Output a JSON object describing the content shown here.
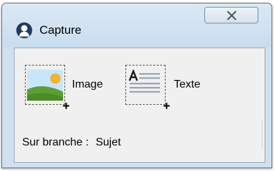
{
  "window": {
    "title": "Capture"
  },
  "icons": {
    "app": "user-silhouette-icon",
    "close": "close-x-icon",
    "image": "picture-icon",
    "text": "text-document-icon",
    "plus": "plus-icon"
  },
  "colors": {
    "titlebar": "#cfe0f1",
    "client": "#f0f0f0",
    "image_sky": "#c8e6f8",
    "image_sun": "#f2b233",
    "image_grass": "#5c9e34"
  },
  "buttons": {
    "image_label": "Image",
    "text_label": "Texte"
  },
  "branch": {
    "label": "Sur branche :",
    "value": "Sujet"
  }
}
